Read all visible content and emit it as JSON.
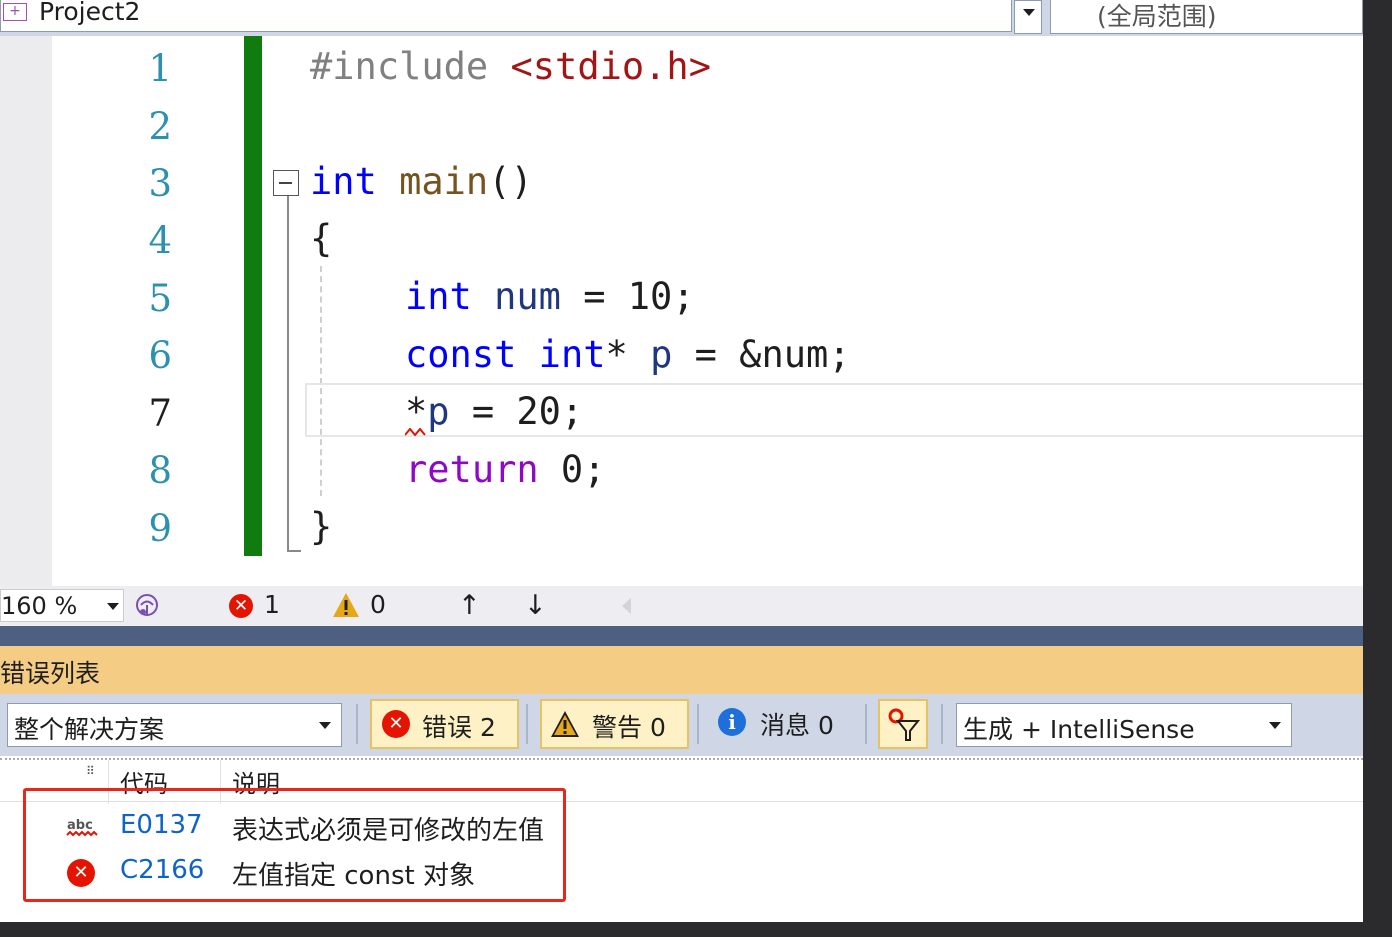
{
  "navbar": {
    "project": "Project2",
    "scope": "(全局范围)"
  },
  "editor": {
    "line_numbers": [
      "1",
      "2",
      "3",
      "4",
      "5",
      "6",
      "7",
      "8",
      "9"
    ],
    "current_line": 7,
    "lines": {
      "l1_directive": "#include",
      "l1_header": "<stdio.h>",
      "l3_type": "int",
      "l3_name": "main",
      "l3_parens": "()",
      "l4": "{",
      "l5_type": "int",
      "l5_var": "num",
      "l5_rest": " = 10;",
      "l6_const": "const",
      "l6_type": "int",
      "l6_star": "*",
      "l6_var": "p",
      "l6_rest": " = &num;",
      "l7_star": "*",
      "l7_var": "p",
      "l7_rest": " = 20;",
      "l8_kw": "return",
      "l8_rest": " 0;",
      "l9": "}"
    }
  },
  "status": {
    "zoom": "160 %",
    "error_count": "1",
    "warning_count": "0",
    "up": "↑",
    "down": "↓"
  },
  "error_list": {
    "title": "错误列表",
    "scope": "整个解决方案",
    "errors_label": "错误 2",
    "warnings_label": "警告 0",
    "messages_label": "消息 0",
    "build_filter": "生成 + IntelliSense",
    "col_code": "代码",
    "col_desc": "说明",
    "rows": [
      {
        "icon": "intellisense-abc-icon",
        "code": "E0137",
        "desc": "表达式必须是可修改的左值"
      },
      {
        "icon": "error-icon",
        "code": "C2166",
        "desc": "左值指定 const 对象"
      }
    ]
  },
  "colors": {
    "keyword": "#0000ff",
    "error": "#e51400",
    "change_bar": "#107c10",
    "panel_title": "#f5cc84",
    "highlight_box": "#e8271a"
  }
}
